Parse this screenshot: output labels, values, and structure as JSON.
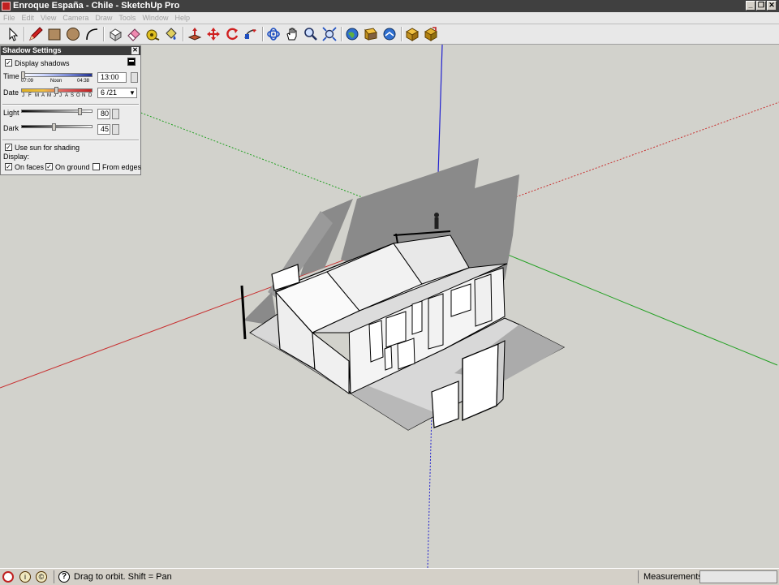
{
  "window": {
    "title": "Enroque España - Chile - SketchUp Pro",
    "minimize_label": "_",
    "restore_label": "❐",
    "close_label": "✕"
  },
  "menus": [
    "File",
    "Edit",
    "View",
    "Camera",
    "Draw",
    "Tools",
    "Window",
    "Help"
  ],
  "toolbar": {
    "tools": [
      "select-icon",
      "pencil-icon",
      "rectangle-icon",
      "circle-icon",
      "arc-icon",
      "make-component-icon",
      "eraser-icon",
      "tape-measure-icon",
      "paint-bucket-icon",
      "push-pull-icon",
      "move-icon",
      "rotate-icon",
      "follow-me-icon",
      "orbit-icon",
      "pan-icon",
      "zoom-icon",
      "zoom-extents-icon",
      "get-models-icon",
      "share-model-icon",
      "share-component-icon",
      "extension-warehouse-icon",
      "extension-manager-icon"
    ]
  },
  "shadow_panel": {
    "title": "Shadow Settings",
    "close_label": "✕",
    "display_shadows_label": "Display shadows",
    "display_shadows_checked": "✓",
    "time_label": "Time",
    "time_start": "07:09",
    "time_noon": "Noon",
    "time_end": "04:38",
    "time_value": "13:00",
    "date_label": "Date",
    "months": [
      "J",
      "F",
      "M",
      "A",
      "M",
      "J",
      "J",
      "A",
      "S",
      "O",
      "N",
      "D"
    ],
    "date_value": "6 /21",
    "light_label": "Light",
    "light_value": "80",
    "dark_label": "Dark",
    "dark_value": "45",
    "use_sun_label": "Use sun for shading",
    "use_sun_checked": "✓",
    "display_label": "Display:",
    "on_faces_label": "On faces",
    "on_faces_checked": "✓",
    "on_ground_label": "On ground",
    "on_ground_checked": "✓",
    "from_edges_label": "From edges",
    "from_edges_checked": ""
  },
  "status_bar": {
    "icons": [
      "geo-location-icon",
      "credits-icon",
      "copyright-icon",
      "help-icon"
    ],
    "hint": "Drag to orbit.  Shift = Pan",
    "measurements_label": "Measurements",
    "measurements_value": ""
  },
  "colors": {
    "viewport_bg": "#d2d2cc",
    "axis_red": "#c83030",
    "axis_green": "#20a020",
    "axis_blue": "#2020d0",
    "shadow": "#8a8a8a"
  }
}
